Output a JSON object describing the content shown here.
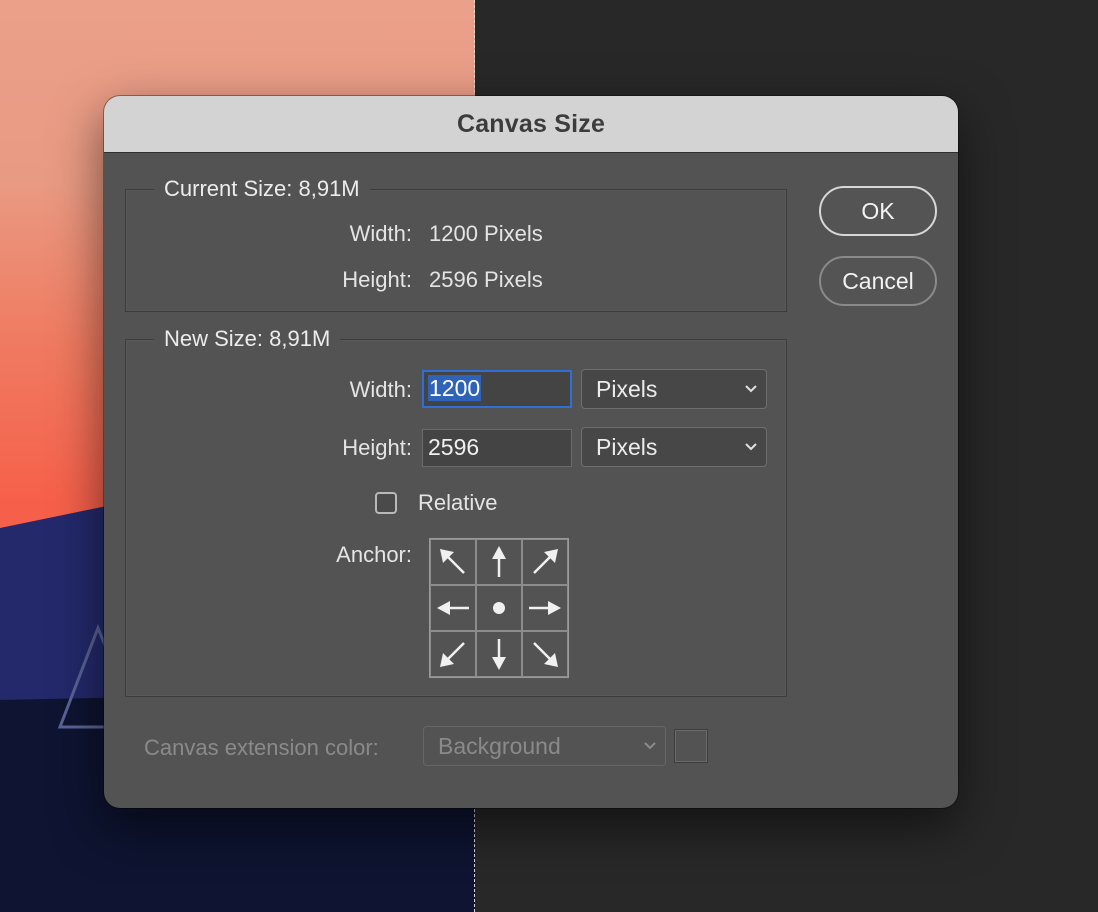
{
  "dialog": {
    "title": "Canvas Size",
    "ok_label": "OK",
    "cancel_label": "Cancel"
  },
  "current_size": {
    "legend": "Current Size: 8,91M",
    "width_label": "Width:",
    "width_value": "1200 Pixels",
    "height_label": "Height:",
    "height_value": "2596 Pixels"
  },
  "new_size": {
    "legend": "New Size: 8,91M",
    "width_label": "Width:",
    "width_value": "1200",
    "width_unit": "Pixels",
    "height_label": "Height:",
    "height_value": "2596",
    "height_unit": "Pixels",
    "relative_label": "Relative",
    "relative_checked": false,
    "anchor_label": "Anchor:",
    "anchor_selected": "center"
  },
  "extension": {
    "label": "Canvas extension color:",
    "value": "Background"
  },
  "colors": {
    "dialog_bg": "#535353",
    "titlebar_bg": "#d3d3d3",
    "focus_ring": "#2f6fd6",
    "selection": "#2f63b8"
  },
  "icons": {
    "anchor": [
      "arrow-up-left-icon",
      "arrow-up-icon",
      "arrow-up-right-icon",
      "arrow-left-icon",
      "anchor-center-dot-icon",
      "arrow-right-icon",
      "arrow-down-left-icon",
      "arrow-down-icon",
      "arrow-down-right-icon"
    ],
    "dropdown": "chevron-down-icon"
  }
}
